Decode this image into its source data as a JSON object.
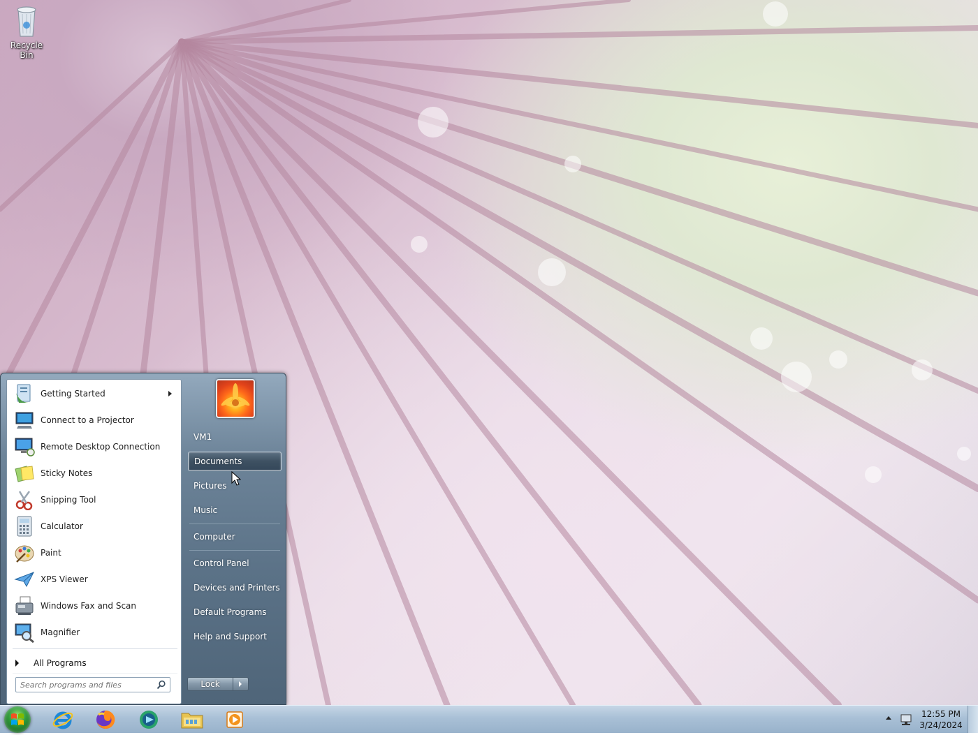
{
  "desktop": {
    "icons": [
      {
        "label": "Recycle Bin",
        "icon": "recycle-bin-icon"
      }
    ]
  },
  "start_menu": {
    "programs": [
      {
        "label": "Getting Started",
        "icon": "getting-started-icon",
        "has_submenu": true
      },
      {
        "label": "Connect to a Projector",
        "icon": "projector-icon",
        "has_submenu": false
      },
      {
        "label": "Remote Desktop Connection",
        "icon": "remote-desktop-icon",
        "has_submenu": false
      },
      {
        "label": "Sticky Notes",
        "icon": "sticky-notes-icon",
        "has_submenu": false
      },
      {
        "label": "Snipping Tool",
        "icon": "snipping-tool-icon",
        "has_submenu": false
      },
      {
        "label": "Calculator",
        "icon": "calculator-icon",
        "has_submenu": false
      },
      {
        "label": "Paint",
        "icon": "paint-icon",
        "has_submenu": false
      },
      {
        "label": "XPS Viewer",
        "icon": "xps-viewer-icon",
        "has_submenu": false
      },
      {
        "label": "Windows Fax and Scan",
        "icon": "fax-scan-icon",
        "has_submenu": false
      },
      {
        "label": "Magnifier",
        "icon": "magnifier-icon",
        "has_submenu": false
      }
    ],
    "all_programs_label": "All Programs",
    "search_placeholder": "Search programs and files",
    "user_name": "VM1",
    "links": [
      {
        "label": "Documents",
        "highlighted": true
      },
      {
        "label": "Pictures",
        "highlighted": false
      },
      {
        "label": "Music",
        "highlighted": false
      },
      {
        "label": "Computer",
        "highlighted": false
      },
      {
        "label": "Control Panel",
        "highlighted": false
      },
      {
        "label": "Devices and Printers",
        "highlighted": false
      },
      {
        "label": "Default Programs",
        "highlighted": false
      },
      {
        "label": "Help and Support",
        "highlighted": false
      }
    ],
    "power_button_label": "Lock"
  },
  "taskbar": {
    "pinned": [
      {
        "name": "Internet Explorer",
        "icon": "internet-explorer-icon"
      },
      {
        "name": "Firefox",
        "icon": "firefox-icon"
      },
      {
        "name": "Media Center",
        "icon": "media-center-icon"
      },
      {
        "name": "Windows Explorer",
        "icon": "folder-icon"
      },
      {
        "name": "Windows Media Player",
        "icon": "media-player-icon"
      }
    ],
    "clock": {
      "time": "12:55 PM",
      "date": "3/24/2024"
    }
  },
  "colors": {
    "start_menu_frame": "#5b7287",
    "taskbar": "#a9c0d6",
    "highlight": "#3e5162"
  }
}
